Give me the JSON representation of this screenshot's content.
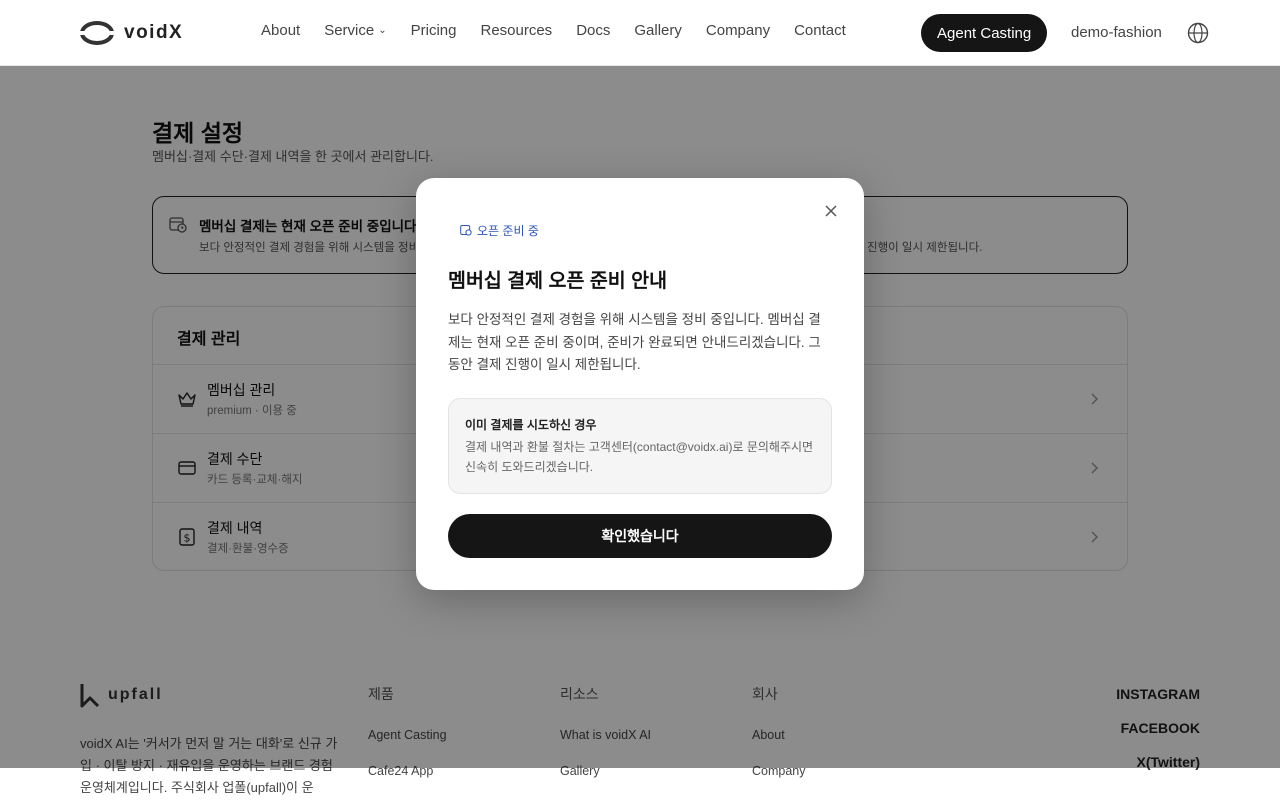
{
  "header": {
    "brand": "voidX",
    "nav": [
      {
        "label": "About"
      },
      {
        "label": "Service"
      },
      {
        "label": "Pricing"
      },
      {
        "label": "Resources"
      },
      {
        "label": "Docs"
      },
      {
        "label": "Gallery"
      },
      {
        "label": "Company"
      },
      {
        "label": "Contact"
      }
    ],
    "cta_label": "Agent Casting",
    "account_label": "demo-fashion",
    "language_icon": "globe-icon"
  },
  "page": {
    "title": "결제 설정",
    "subtitle": "멤버십·결제 수단·결제 내역을 한 곳에서 관리합니다.",
    "notice": {
      "icon": "calendar-clock-icon",
      "title": "멤버십 결제는 현재 오픈 준비 중입니다.",
      "desc": "보다 안정적인 결제 경험을 위해 시스템을 정비",
      "desc_tail": "진행이 일시 제한됩니다."
    },
    "card": {
      "title": "결제 관리",
      "rows": [
        {
          "icon": "crown-icon",
          "label": "멤버십 관리",
          "sub": "premium · 이용 중"
        },
        {
          "icon": "credit-card-icon",
          "label": "결제 수단",
          "sub": "카드 등록·교체·해지"
        },
        {
          "icon": "receipt-icon",
          "label": "결제 내역",
          "sub": "결제·환불·영수증"
        }
      ]
    }
  },
  "footer": {
    "brand": "upfall",
    "desc": "voidX AI는 '커서가 먼저 말 거는 대화'로 신규 가입 · 이탈 방지 · 재유입을 운영하는 브랜드 경험 운영체계입니다. 주식회사 업폴(upfall)이 운",
    "columns": [
      {
        "head": "제품",
        "items": [
          "Agent Casting",
          "Cafe24 App"
        ]
      },
      {
        "head": "리소스",
        "items": [
          "What is voidX AI",
          "Gallery"
        ]
      },
      {
        "head": "회사",
        "items": [
          "About",
          "Company"
        ]
      }
    ],
    "social": [
      "INSTAGRAM",
      "FACEBOOK",
      "X(Twitter)"
    ]
  },
  "modal": {
    "badge": "오픈 준비 중",
    "title": "멤버십 결제 오픈 준비 안내",
    "body": "보다 안정적인 결제 경험을 위해 시스템을 정비 중입니다. 멤버십 결제는 현재 오픈 준비 중이며, 준비가 완료되면 안내드리겠습니다. 그동안 결제 진행이 일시 제한됩니다.",
    "info_title": "이미 결제를 시도하신 경우",
    "info_desc": "결제 내역과 환불 절차는 고객센터(contact@voidx.ai)로 문의해주시면 신속히 도와드리겠습니다.",
    "confirm_label": "확인했습니다"
  },
  "colors": {
    "primary_dark": "#151515",
    "badge_blue": "#2d55b8",
    "overlay": "rgba(0,0,0,0.45)"
  }
}
